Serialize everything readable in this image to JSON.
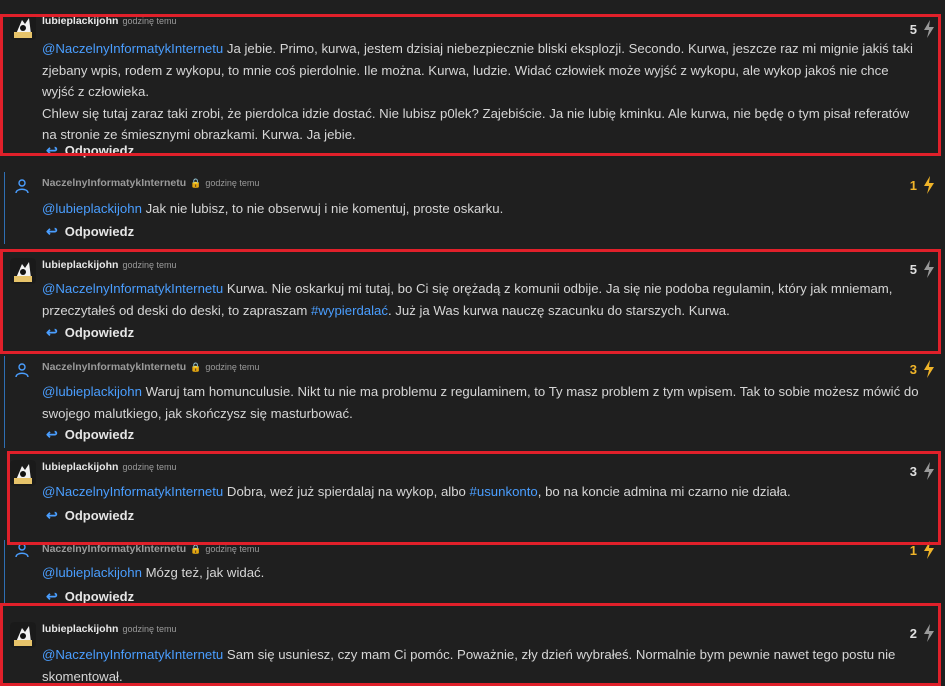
{
  "reply_label": "Odpowiedz",
  "colors": {
    "accent": "#4a9eff",
    "highlight": "#e0202a",
    "hot": "#f0b429"
  },
  "comments": [
    {
      "author": "lubieplackijohn",
      "time": "godzinę temu",
      "score": "5",
      "mention": "@NaczelnyInformatykInternetu",
      "text_a": " Ja jebie. Primo, kurwa, jestem dzisiaj niebezpiecznie bliski eksplozji. Secondo. Kurwa, jeszcze raz mi mignie jakiś taki zjebany wpis, rodem z wykopu, to mnie coś pierdolnie. Ile można. Kurwa, ludzie. Widać człowiek może wyjść z wykopu, ale wykop jakoś nie chce wyjść z człowieka.",
      "text_b": "Chlew się tutaj zaraz taki zrobi, że pierdolca idzie dostać. Nie lubisz p0lek? Zajebiście. Ja nie lubię kminku. Ale kurwa, nie będę o tym pisał referatów na stronie ze śmiesznymi obrazkami. Kurwa. Ja jebie."
    },
    {
      "author": "NaczelnyInformatykInternetu",
      "time": "godzinę temu",
      "score": "1",
      "mention": "@lubieplackijohn",
      "text_a": " Jak nie lubisz, to nie obserwuj i nie komentuj, proste oskarku."
    },
    {
      "author": "lubieplackijohn",
      "time": "godzinę temu",
      "score": "5",
      "mention": "@NaczelnyInformatykInternetu",
      "text_a": " Kurwa. Nie oskarkuj mi tutaj, bo Ci się orężadą z komunii odbije. Ja się nie podoba regulamin, który jak mniemam, przeczytałeś od deski do deski, to zapraszam ",
      "hashtag": "#wypierdalać",
      "text_c": ". Już ja Was kurwa nauczę szacunku do starszych. Kurwa."
    },
    {
      "author": "NaczelnyInformatykInternetu",
      "time": "godzinę temu",
      "score": "3",
      "mention": "@lubieplackijohn",
      "text_a": " Waruj tam homunculusie. Nikt tu nie ma problemu z regulaminem, to Ty masz problem z tym wpisem. Tak to sobie możesz mówić do swojego malutkiego, jak skończysz się masturbować."
    },
    {
      "author": "lubieplackijohn",
      "time": "godzinę temu",
      "score": "3",
      "mention": "@NaczelnyInformatykInternetu",
      "text_a": " Dobra, weź już spierdalaj na wykop, albo ",
      "hashtag": "#usunkonto",
      "text_c": ", bo na koncie admina mi czarno nie działa."
    },
    {
      "author": "NaczelnyInformatykInternetu",
      "time": "godzinę temu",
      "score": "1",
      "mention": "@lubieplackijohn",
      "text_a": " Mózg też, jak widać."
    },
    {
      "author": "lubieplackijohn",
      "time": "godzinę temu",
      "score": "2",
      "mention": "@NaczelnyInformatykInternetu",
      "text_a": " Sam się usuniesz, czy mam Ci pomóc. Poważnie, zły dzień wybrałeś. Normalnie bym pewnie nawet tego postu nie skomentował."
    }
  ]
}
